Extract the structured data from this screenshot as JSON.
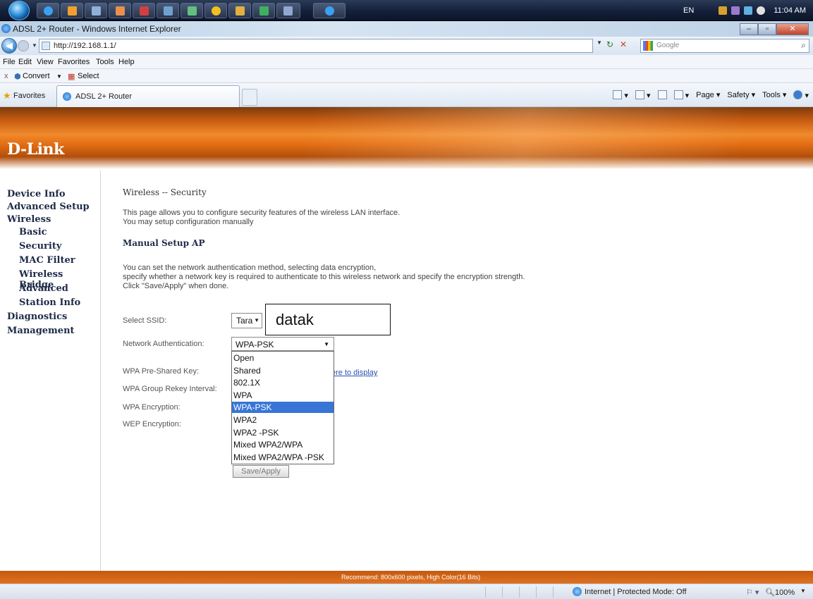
{
  "taskbar": {
    "language": "EN",
    "clock": "11:04 AM"
  },
  "window": {
    "title": "ADSL 2+ Router - Windows Internet Explorer"
  },
  "address": {
    "url": "http://192.168.1.1/",
    "search_placeholder": "Google"
  },
  "menu": [
    "File",
    "Edit",
    "View",
    "Favorites",
    "Tools",
    "Help"
  ],
  "convertbar": {
    "close": "x",
    "convert": "Convert",
    "select": "Select"
  },
  "favbar": {
    "favorites": "Favorites",
    "tab_title": "ADSL 2+ Router",
    "page": "Page",
    "safety": "Safety",
    "tools": "Tools"
  },
  "brand": {
    "logo": "D-Link"
  },
  "sidebar": {
    "items": [
      {
        "label": "Device Info"
      },
      {
        "label": "Advanced Setup"
      },
      {
        "label": "Wireless"
      },
      {
        "label": "Basic"
      },
      {
        "label": "Security"
      },
      {
        "label": "MAC Filter"
      },
      {
        "label": "Wireless Bridge"
      },
      {
        "label": "Advanced"
      },
      {
        "label": "Station Info"
      },
      {
        "label": "Diagnostics"
      },
      {
        "label": "Management"
      }
    ]
  },
  "content": {
    "breadcrumb": "Wireless -- Security",
    "intro_1": "This page allows you to configure security features of the wireless LAN interface.",
    "intro_2": "You may setup configuration manually",
    "section": "Manual Setup AP",
    "desc_1": "You can set the network authentication method, selecting data encryption,",
    "desc_2": "specify whether a network key is required to authenticate to this wireless network and specify the encryption strength.",
    "desc_3": "Click \"Save/Apply\" when done.",
    "ssid_label": "Select SSID:",
    "ssid_value": "Tara",
    "ssid_annotation": "datak",
    "auth_label": "Network Authentication:",
    "auth_value": "WPA-PSK",
    "psk_label": "WPA Pre-Shared Key:",
    "psk_link": "ere to display",
    "rekey_label": "WPA Group Rekey Interval:",
    "enc_label": "WPA Encryption:",
    "wep_label": "WEP Encryption:",
    "save_button": "Save/Apply",
    "auth_options": [
      "Open",
      "Shared",
      "802.1X",
      "WPA",
      "WPA-PSK",
      "WPA2",
      "WPA2 -PSK",
      "Mixed WPA2/WPA",
      "Mixed WPA2/WPA -PSK"
    ],
    "auth_selected_index": 4
  },
  "footer": {
    "text": "Recommend: 800x600 pixels, High Color(16 Bits)"
  },
  "status": {
    "zone": "Internet | Protected Mode: Off",
    "zoom": "100%"
  }
}
